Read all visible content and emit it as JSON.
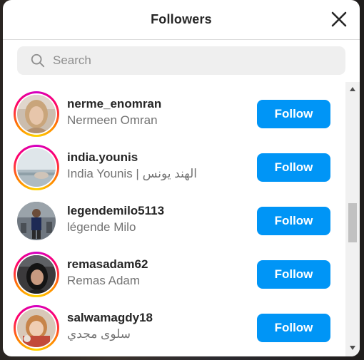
{
  "modal": {
    "title": "Followers"
  },
  "search": {
    "placeholder": "Search"
  },
  "icons": {
    "close": "close-icon",
    "search": "search-icon",
    "scroll_up": "triangle-up-icon",
    "scroll_down": "triangle-down-icon"
  },
  "colors": {
    "follow_button": "#0095f6",
    "story_ring": [
      "#d300c5",
      "#ff0069",
      "#ff7a00",
      "#ffd600"
    ],
    "username": "#262626",
    "fullname": "#737373"
  },
  "followers": [
    {
      "username": "nerme_enomran",
      "fullname": "Nermeen Omran",
      "action": "Follow",
      "story_ring": true
    },
    {
      "username": "india.younis",
      "fullname": "India Younis | الهند يونس",
      "action": "Follow",
      "story_ring": true
    },
    {
      "username": "legendemilo5113",
      "fullname": "légende Milo",
      "action": "Follow",
      "story_ring": false
    },
    {
      "username": "remasadam62",
      "fullname": "Remas Adam",
      "action": "Follow",
      "story_ring": true
    },
    {
      "username": "salwamagdy18",
      "fullname": "سلوى مجدي",
      "action": "Follow",
      "story_ring": true
    }
  ]
}
